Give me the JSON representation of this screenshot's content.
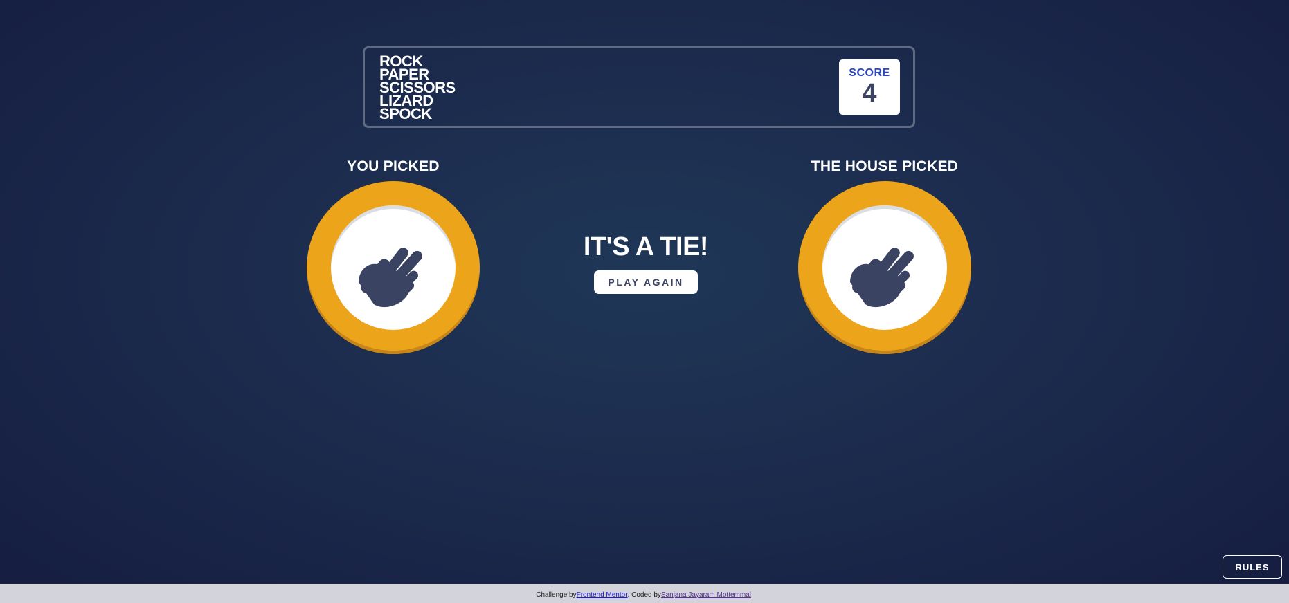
{
  "header": {
    "title_lines": [
      "ROCK",
      "PAPER",
      "SCISSORS",
      "LIZARD",
      "SPOCK"
    ],
    "score_label": "SCORE",
    "score_value": "4"
  },
  "player": {
    "label": "YOU PICKED",
    "pick_icon": "spock-hand-icon",
    "ring_color": "#eca41b"
  },
  "house": {
    "label": "THE HOUSE PICKED",
    "pick_icon": "spock-hand-icon",
    "ring_color": "#eca41b"
  },
  "result": {
    "text": "IT'S A TIE!",
    "play_again_label": "PLAY AGAIN"
  },
  "rules_label": "RULES",
  "footer": {
    "prefix": "Challenge by ",
    "link1": "Frontend Mentor",
    "middle": ". Coded by ",
    "link2": "Sanjana Jayaram Mottemmal",
    "suffix": "."
  }
}
